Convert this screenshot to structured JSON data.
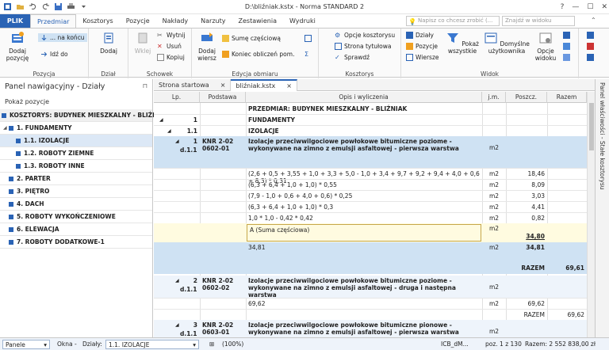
{
  "window": {
    "title": "D:\\bliźniak.kstx - Norma STANDARD 2"
  },
  "ribbon_tabs": [
    "PLIK",
    "Przedmiar",
    "Kosztorys",
    "Pozycje",
    "Nakłady",
    "Narzuty",
    "Zestawienia",
    "Wydruki"
  ],
  "search": {
    "help_placeholder": "Napisz co chcesz zrobić (...",
    "view_placeholder": "Znajdź w widoku"
  },
  "groups": {
    "pozycja": {
      "label": "Pozycja",
      "dodaj": "Dodaj pozycję",
      "na_koncu": "... na końcu",
      "idz_do": "Idź do"
    },
    "dzial": {
      "label": "Dział",
      "dodaj": "Dodaj"
    },
    "schowek": {
      "label": "Schowek",
      "wklej": "Wklej",
      "wytnij": "Wytnij",
      "usun": "Usuń",
      "kopiuj": "Kopiuj"
    },
    "edycja": {
      "label": "Edycja obmiaru",
      "dodaj_wiersz": "Dodaj wiersz",
      "sume": "Sumę częściową",
      "koniec": "Koniec obliczeń pom."
    },
    "kosztorys": {
      "label": "Kosztorys",
      "opcje": "Opcje kosztorysu",
      "strona": "Strona tytułowa",
      "sprawdz": "Sprawdź"
    },
    "widok": {
      "label": "Widok",
      "dzialy": "Działy",
      "pozycje": "Pozycje",
      "wiersze": "Wiersze",
      "pokaz": "Pokaż wszystkie",
      "domyslne": "Domyślne użytkownika",
      "opcje": "Opcje widoku"
    }
  },
  "nav": {
    "title": "Panel nawigacyjny - Działy",
    "subtitle": "Pokaż pozycje",
    "items": [
      {
        "label": "KOSZTORYS: BUDYNEK MIESZKALNY - BLIŹNIAK"
      },
      {
        "label": "1. FUNDAMENTY"
      },
      {
        "label": "1.1. IZOLACJE"
      },
      {
        "label": "1.2. ROBOTY ZIEMNE"
      },
      {
        "label": "1.3. ROBOTY INNE"
      },
      {
        "label": "2. PARTER"
      },
      {
        "label": "3. PIĘTRO"
      },
      {
        "label": "4. DACH"
      },
      {
        "label": "5. ROBOTY WYKOŃCZENIOWE"
      },
      {
        "label": "6. ELEWACJA"
      },
      {
        "label": "7. ROBOTY DODATKOWE-1"
      }
    ]
  },
  "doc_tabs": [
    "Strona startowa",
    "bliźniak.kstx"
  ],
  "grid": {
    "headers": {
      "lp": "Lp.",
      "podstawa": "Podstawa",
      "opis": "Opis i wyliczenia",
      "jm": "j.m.",
      "poszcz": "Poszcz.",
      "razem": "Razem"
    },
    "rows": {
      "przedmiar": "PRZEDMIAR: BUDYNEK MIESZKALNY - BLIŹNIAK",
      "r1_lp": "1",
      "r1_opis": "FUNDAMENTY",
      "r2_lp": "1.1",
      "r2_opis": "IZOLACJE",
      "p1_lp": "1",
      "p1_d": "d.1.1",
      "p1_podstawa": "KNR 2-02 0602-01",
      "p1_opis": "Izolacje przeciwwilgociowe powłokowe bitumiczne poziome - wykonywane na zimno z emulsji asfaltowej - pierwsza warstwa",
      "p1_jm": "m2",
      "o1": "(2,6 + 0,5 + 3,55 + 1,0 + 3,3 + 5,0 - 1,0 + 3,4 + 9,7 + 9,2 + 9,4 + 4,0 + 0,6 + 8,3) * 0,31",
      "o1_jm": "m2",
      "o1_v": "18,46",
      "o2": "(6,3 + 6,4 + 1,0 + 1,0) * 0,55",
      "o2_jm": "m2",
      "o2_v": "8,09",
      "o3": "(7,9 - 1,0 + 0,6 + 4,0 + 0,6) * 0,25",
      "o3_jm": "m2",
      "o3_v": "3,03",
      "o4": "(6,3 + 6,4 + 1,0 + 1,0) * 0,3",
      "o4_jm": "m2",
      "o4_v": "4,41",
      "o5": "1,0 * 1,0 - 0,42 * 0,42",
      "o5_jm": "m2",
      "o5_v": "0,82",
      "suma": "A (Suma częściowa)",
      "suma_jm": "m2",
      "suma_v": "34,80",
      "w1": "34,81",
      "w1_jm": "m2",
      "w1_v": "34,81",
      "razem_label": "RAZEM",
      "razem_v": "69,61",
      "p2_lp": "2",
      "p2_d": "d.1.1",
      "p2_podstawa": "KNR 2-02 0602-02",
      "p2_opis": "Izolacje przeciwwilgociowe powłokowe bitumiczne poziome - wykonywane na zimno z emulsji asfaltowej - druga i następna warstwa",
      "p2_jm": "m2",
      "p2_o": "69,62",
      "p2_o_jm": "m2",
      "p2_o_v": "69,62",
      "p2_razem_label": "RAZEM",
      "p2_razem_v": "69,62",
      "p3_lp": "3",
      "p3_d": "d.1.1",
      "p3_podstawa": "KNR 2-02 0603-01",
      "p3_opis": "Izolacje przeciwwilgociowe powłokowe bitumiczne pionowe - wykonywane na zimno z emulsji asfaltowej - pierwsza warstwa",
      "p3_jm": "m2"
    }
  },
  "side_panel": "Panel właściwości - Stałe kosztorysu",
  "status": {
    "panele": "Panele",
    "okna": "Okna -",
    "dzialy_label": "Działy:",
    "dzialy_value": "1.1. IZOLACJE",
    "zoom": "(100%)",
    "icb": "ICB_dM...",
    "poz": "poz. 1 z 130",
    "razem": "Razem: 2 552 838,00 zł"
  },
  "colors": {
    "accent": "#2a63b5",
    "selection": "#cfe2f3",
    "highlight": "#fffbe0"
  }
}
